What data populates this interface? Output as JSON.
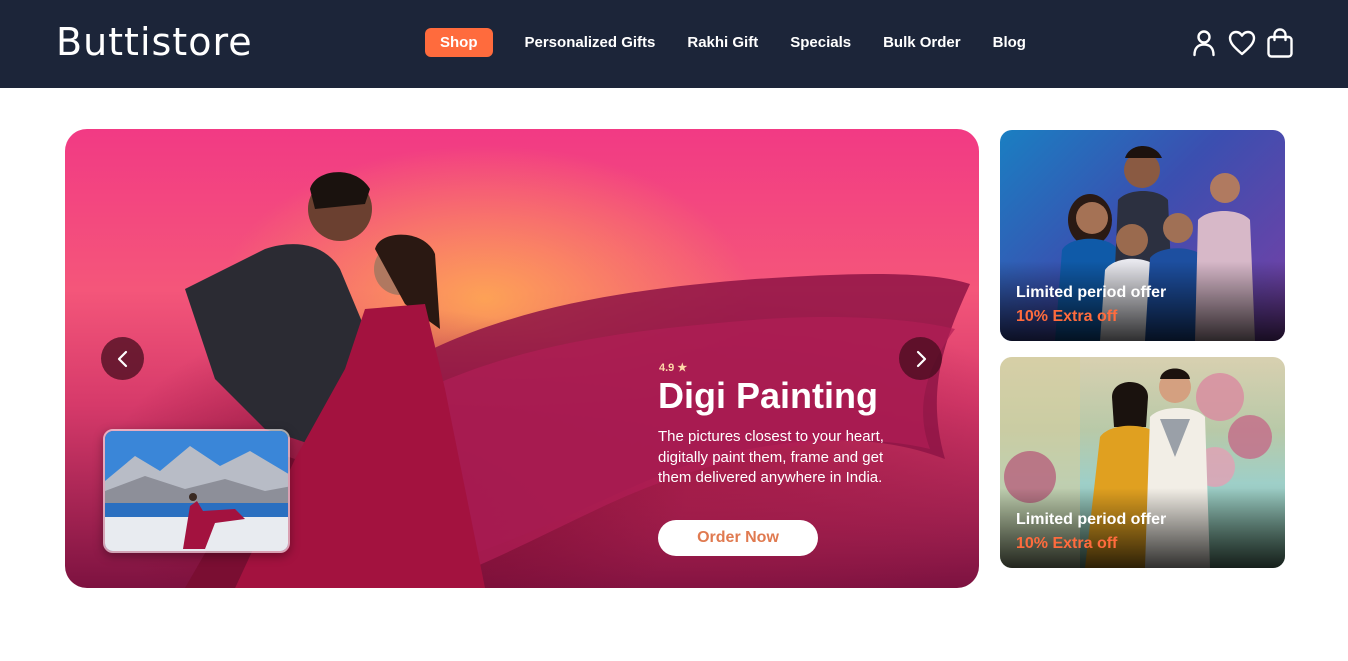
{
  "brand": {
    "logo_text": "Buttistore"
  },
  "nav": {
    "items": [
      {
        "label": "Shop",
        "active": true
      },
      {
        "label": "Personalized Gifts"
      },
      {
        "label": "Rakhi Gift"
      },
      {
        "label": "Specials"
      },
      {
        "label": "Bulk Order"
      },
      {
        "label": "Blog"
      }
    ]
  },
  "header_icons": [
    "user-icon",
    "heart-icon",
    "bag-icon"
  ],
  "hero": {
    "rating": "4.9 ★",
    "title": "Digi Painting",
    "description": "The pictures closest to your heart, digitally paint them, frame and get them delivered anywhere in India.",
    "cta_label": "Order Now"
  },
  "side_cards": [
    {
      "title": "Limited period offer",
      "offer": "10% Extra off"
    },
    {
      "title": "Limited period offer",
      "offer": "10% Extra off"
    }
  ],
  "colors": {
    "header_bg": "#1c2539",
    "accent": "#ff6b3d",
    "cta_text": "#e07a50"
  }
}
